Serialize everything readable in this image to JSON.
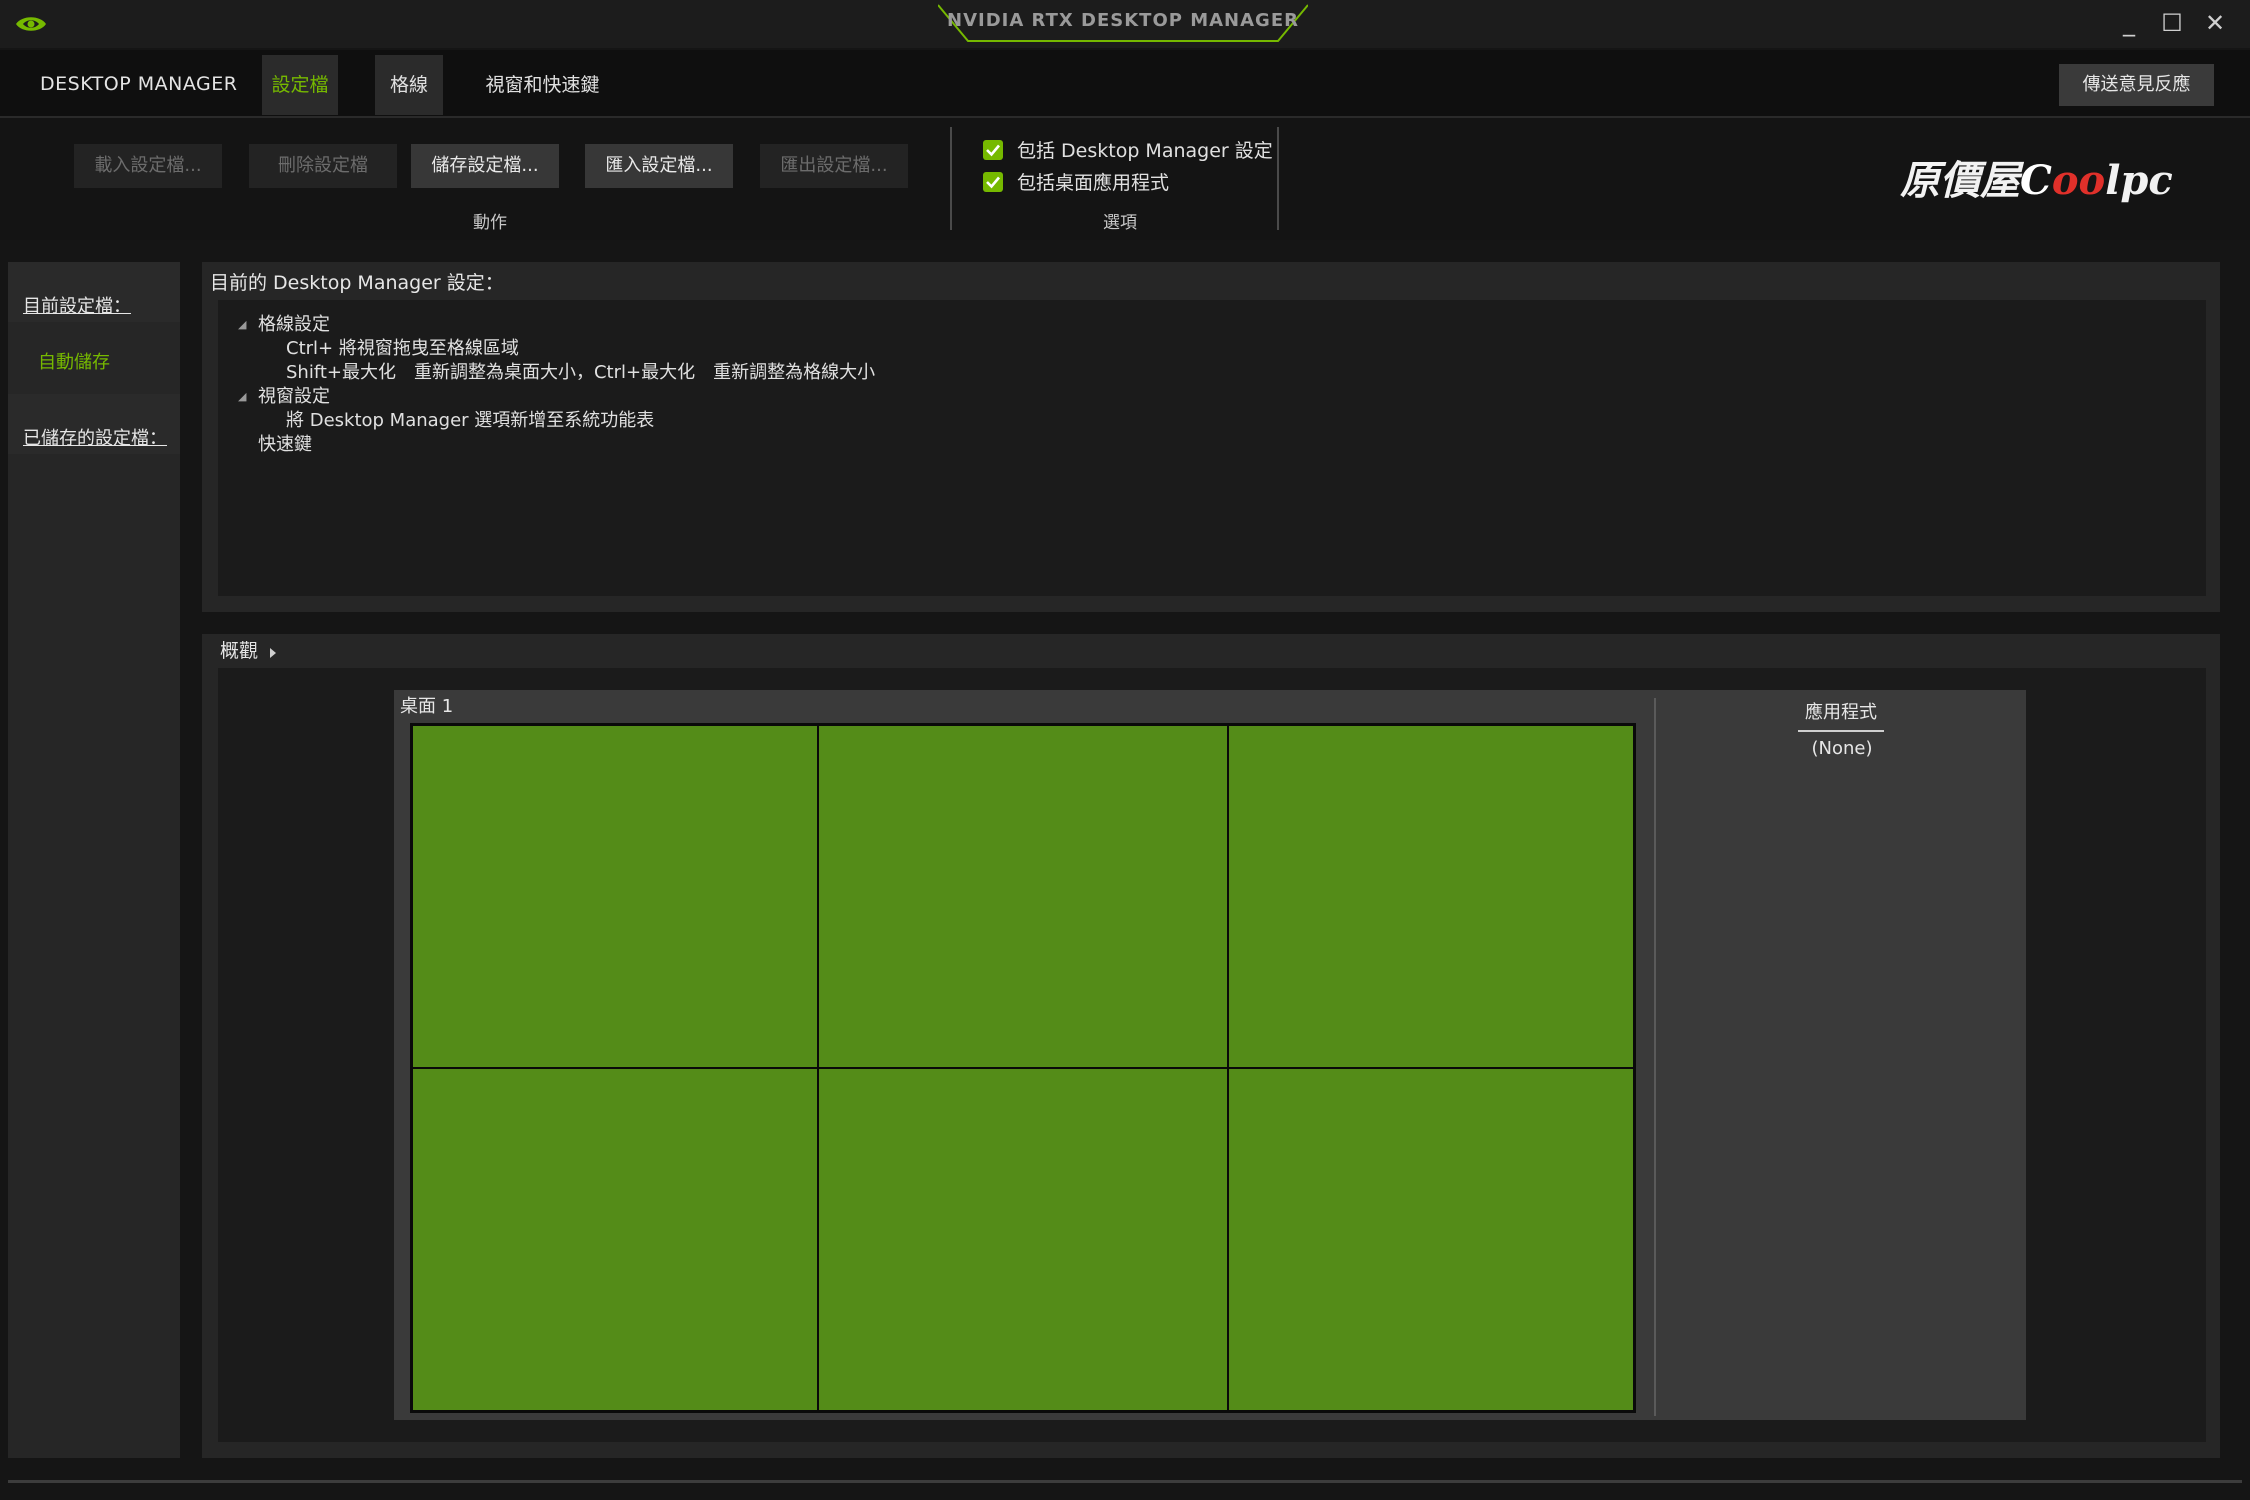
{
  "window": {
    "title": "NVIDIA RTX DESKTOP MANAGER",
    "controls": {
      "minimize": "_",
      "maximize": "☐",
      "close": "✕"
    }
  },
  "menu": {
    "brand": "DESKTOP MANAGER",
    "tabs": [
      {
        "label": "設定檔",
        "active": true
      },
      {
        "label": "格線",
        "active": false
      },
      {
        "label": "視窗和快速鍵",
        "active": false
      }
    ],
    "feedback_label": "傳送意見反應"
  },
  "toolbar": {
    "buttons": [
      {
        "label": "載入設定檔...",
        "enabled": false
      },
      {
        "label": "刪除設定檔",
        "enabled": false
      },
      {
        "label": "儲存設定檔...",
        "enabled": true
      },
      {
        "label": "匯入設定檔...",
        "enabled": true
      },
      {
        "label": "匯出設定檔...",
        "enabled": false
      }
    ],
    "actions_group_label": "動作",
    "options": [
      {
        "label": "包括 Desktop Manager 設定",
        "checked": true
      },
      {
        "label": "包括桌面應用程式",
        "checked": true
      }
    ],
    "options_group_label": "選項",
    "logo": {
      "prefix": "原價屋",
      "brand_c": "C",
      "brand_oo": "oo",
      "brand_rest": "lpc"
    }
  },
  "sidebar": {
    "current_profile_label": "目前設定檔：",
    "current_profile_value": "自動儲存",
    "saved_profiles_label": "已儲存的設定檔："
  },
  "settings": {
    "title": "目前的 Desktop Manager 設定：",
    "tree": {
      "grid_settings": "格線設定",
      "grid_item1": "Ctrl+ 將視窗拖曳至格線區域",
      "grid_item2": "Shift+最大化　重新調整為桌面大小，Ctrl+最大化　重新調整為格線大小",
      "window_settings": "視窗設定",
      "window_item1": "將 Desktop Manager 選項新增至系統功能表",
      "hotkeys": "快速鍵"
    }
  },
  "overview": {
    "label": "概觀",
    "desktop_label": "桌面 1",
    "grid": {
      "rows": 2,
      "columns": 3,
      "color": "#548c18"
    },
    "apps_title": "應用程式",
    "apps_value": "(None)"
  },
  "colors": {
    "accent": "#76b900",
    "background": "#151515",
    "panel": "#262626"
  }
}
